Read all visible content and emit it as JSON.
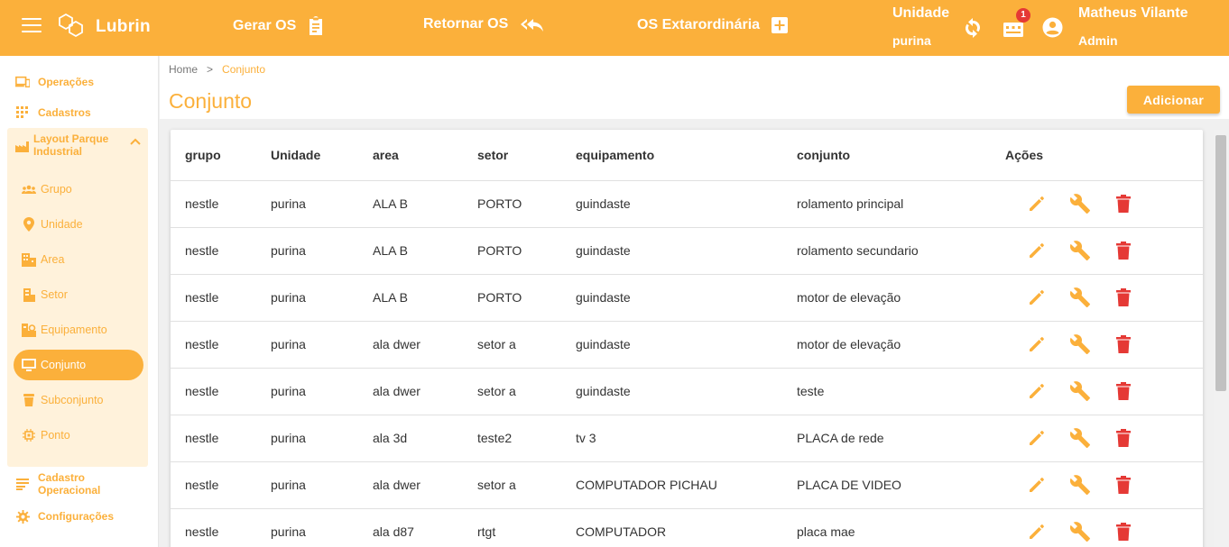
{
  "topbar": {
    "brand": "Lubrin",
    "actions": [
      {
        "label": "Gerar OS",
        "icon": "clipboard-icon"
      },
      {
        "label": "Retornar OS",
        "icon": "reply-all-icon"
      },
      {
        "label": "OS Extarordinária",
        "icon": "add-box-icon"
      }
    ],
    "unit_label": "Unidade",
    "unit_value": "purina",
    "notification_count": "1",
    "user_name": "Matheus Vilante",
    "user_role": "Admin"
  },
  "sidebar": {
    "items_top": [
      {
        "label": "Operações",
        "icon": "devices-icon"
      },
      {
        "label": "Cadastros",
        "icon": "grid-icon"
      }
    ],
    "group": {
      "label": "Layout Parque Industrial",
      "icon": "factory-icon",
      "items": [
        {
          "label": "Grupo",
          "icon": "group-icon"
        },
        {
          "label": "Unidade",
          "icon": "location-pin-icon"
        },
        {
          "label": "Area",
          "icon": "buildings-icon"
        },
        {
          "label": "Setor",
          "icon": "sector-icon"
        },
        {
          "label": "Equipamento",
          "icon": "equipment-icon"
        },
        {
          "label": "Conjunto",
          "icon": "monitor-icon",
          "active": true
        },
        {
          "label": "Subconjunto",
          "icon": "bucket-icon"
        },
        {
          "label": "Ponto",
          "icon": "chip-icon"
        }
      ]
    },
    "items_bottom": [
      {
        "label": "Cadastro Operacional",
        "icon": "list-icon"
      },
      {
        "label": "Configurações",
        "icon": "gear-icon"
      }
    ]
  },
  "breadcrumb": {
    "home": "Home",
    "separator": ">",
    "current": "Conjunto"
  },
  "page": {
    "title": "Conjunto",
    "add_label": "Adicionar"
  },
  "table": {
    "columns": [
      "grupo",
      "Unidade",
      "area",
      "setor",
      "equipamento",
      "conjunto",
      "Ações"
    ],
    "rows": [
      [
        "nestle",
        "purina",
        "ALA B",
        "PORTO",
        "guindaste",
        "rolamento principal"
      ],
      [
        "nestle",
        "purina",
        "ALA B",
        "PORTO",
        "guindaste",
        "rolamento secundario"
      ],
      [
        "nestle",
        "purina",
        "ALA B",
        "PORTO",
        "guindaste",
        "motor de elevação"
      ],
      [
        "nestle",
        "purina",
        "ala dwer",
        "setor a",
        "guindaste",
        "motor de elevação"
      ],
      [
        "nestle",
        "purina",
        "ala dwer",
        "setor a",
        "guindaste",
        "teste"
      ],
      [
        "nestle",
        "purina",
        "ala 3d",
        "teste2",
        "tv 3",
        "PLACA de rede"
      ],
      [
        "nestle",
        "purina",
        "ala dwer",
        "setor a",
        "COMPUTADOR PICHAU",
        "PLACA DE VIDEO"
      ],
      [
        "nestle",
        "purina",
        "ala d87",
        "rtgt",
        "COMPUTADOR",
        "placa mae"
      ]
    ],
    "row_actions": [
      "edit-icon",
      "wrench-icon",
      "delete-icon"
    ]
  },
  "colors": {
    "accent": "#fbb03b",
    "accent_light": "#fff2db",
    "delete": "#e53935"
  }
}
